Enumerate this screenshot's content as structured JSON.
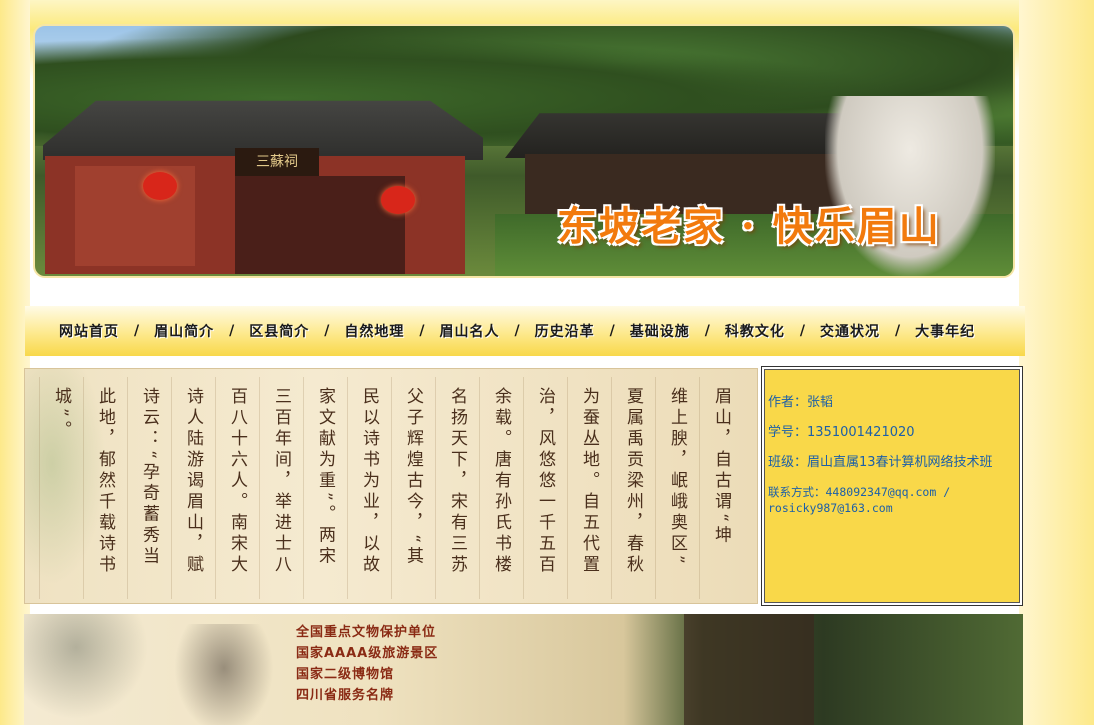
{
  "banner": {
    "plaque": "三蘇祠",
    "slogan": "东坡老家 · 快乐眉山"
  },
  "nav": {
    "items": [
      "网站首页",
      "眉山简介",
      "区县简介",
      "自然地理",
      "眉山名人",
      "历史沿革",
      "基础设施",
      "科教文化",
      "交通状况",
      "大事年纪"
    ],
    "separator": "/"
  },
  "scroll": {
    "columns": [
      "眉山，自古谓“坤",
      "维上腴，岷峨奥区”",
      "夏属禹贡梁州，春秋",
      "为蚕丛地。自五代置",
      "治，风悠悠一千五百",
      "余载。唐有孙氏书楼",
      "名扬天下，宋有三苏",
      "父子辉煌古今，“其",
      "民以诗书为业，以故",
      "家文献为重”。两宋",
      "三百年间，举进士八",
      "百八十六人。南宋大",
      "诗人陆游谒眉山，赋",
      "诗云：“孕奇蓄秀当",
      "此地，郁然千载诗书",
      "城”。"
    ]
  },
  "info": {
    "author": "作者：张韬",
    "student_id": "学号：1351001421020",
    "class": "班级：眉山直属13春计算机网络技术班",
    "contact": "联系方式：448092347@qq.com / rosicky987@163.com"
  },
  "bottom": {
    "items": [
      "全国重点文物保护单位",
      "国家AAAA级旅游景区",
      "国家二级博物馆",
      "四川省服务名牌"
    ]
  }
}
